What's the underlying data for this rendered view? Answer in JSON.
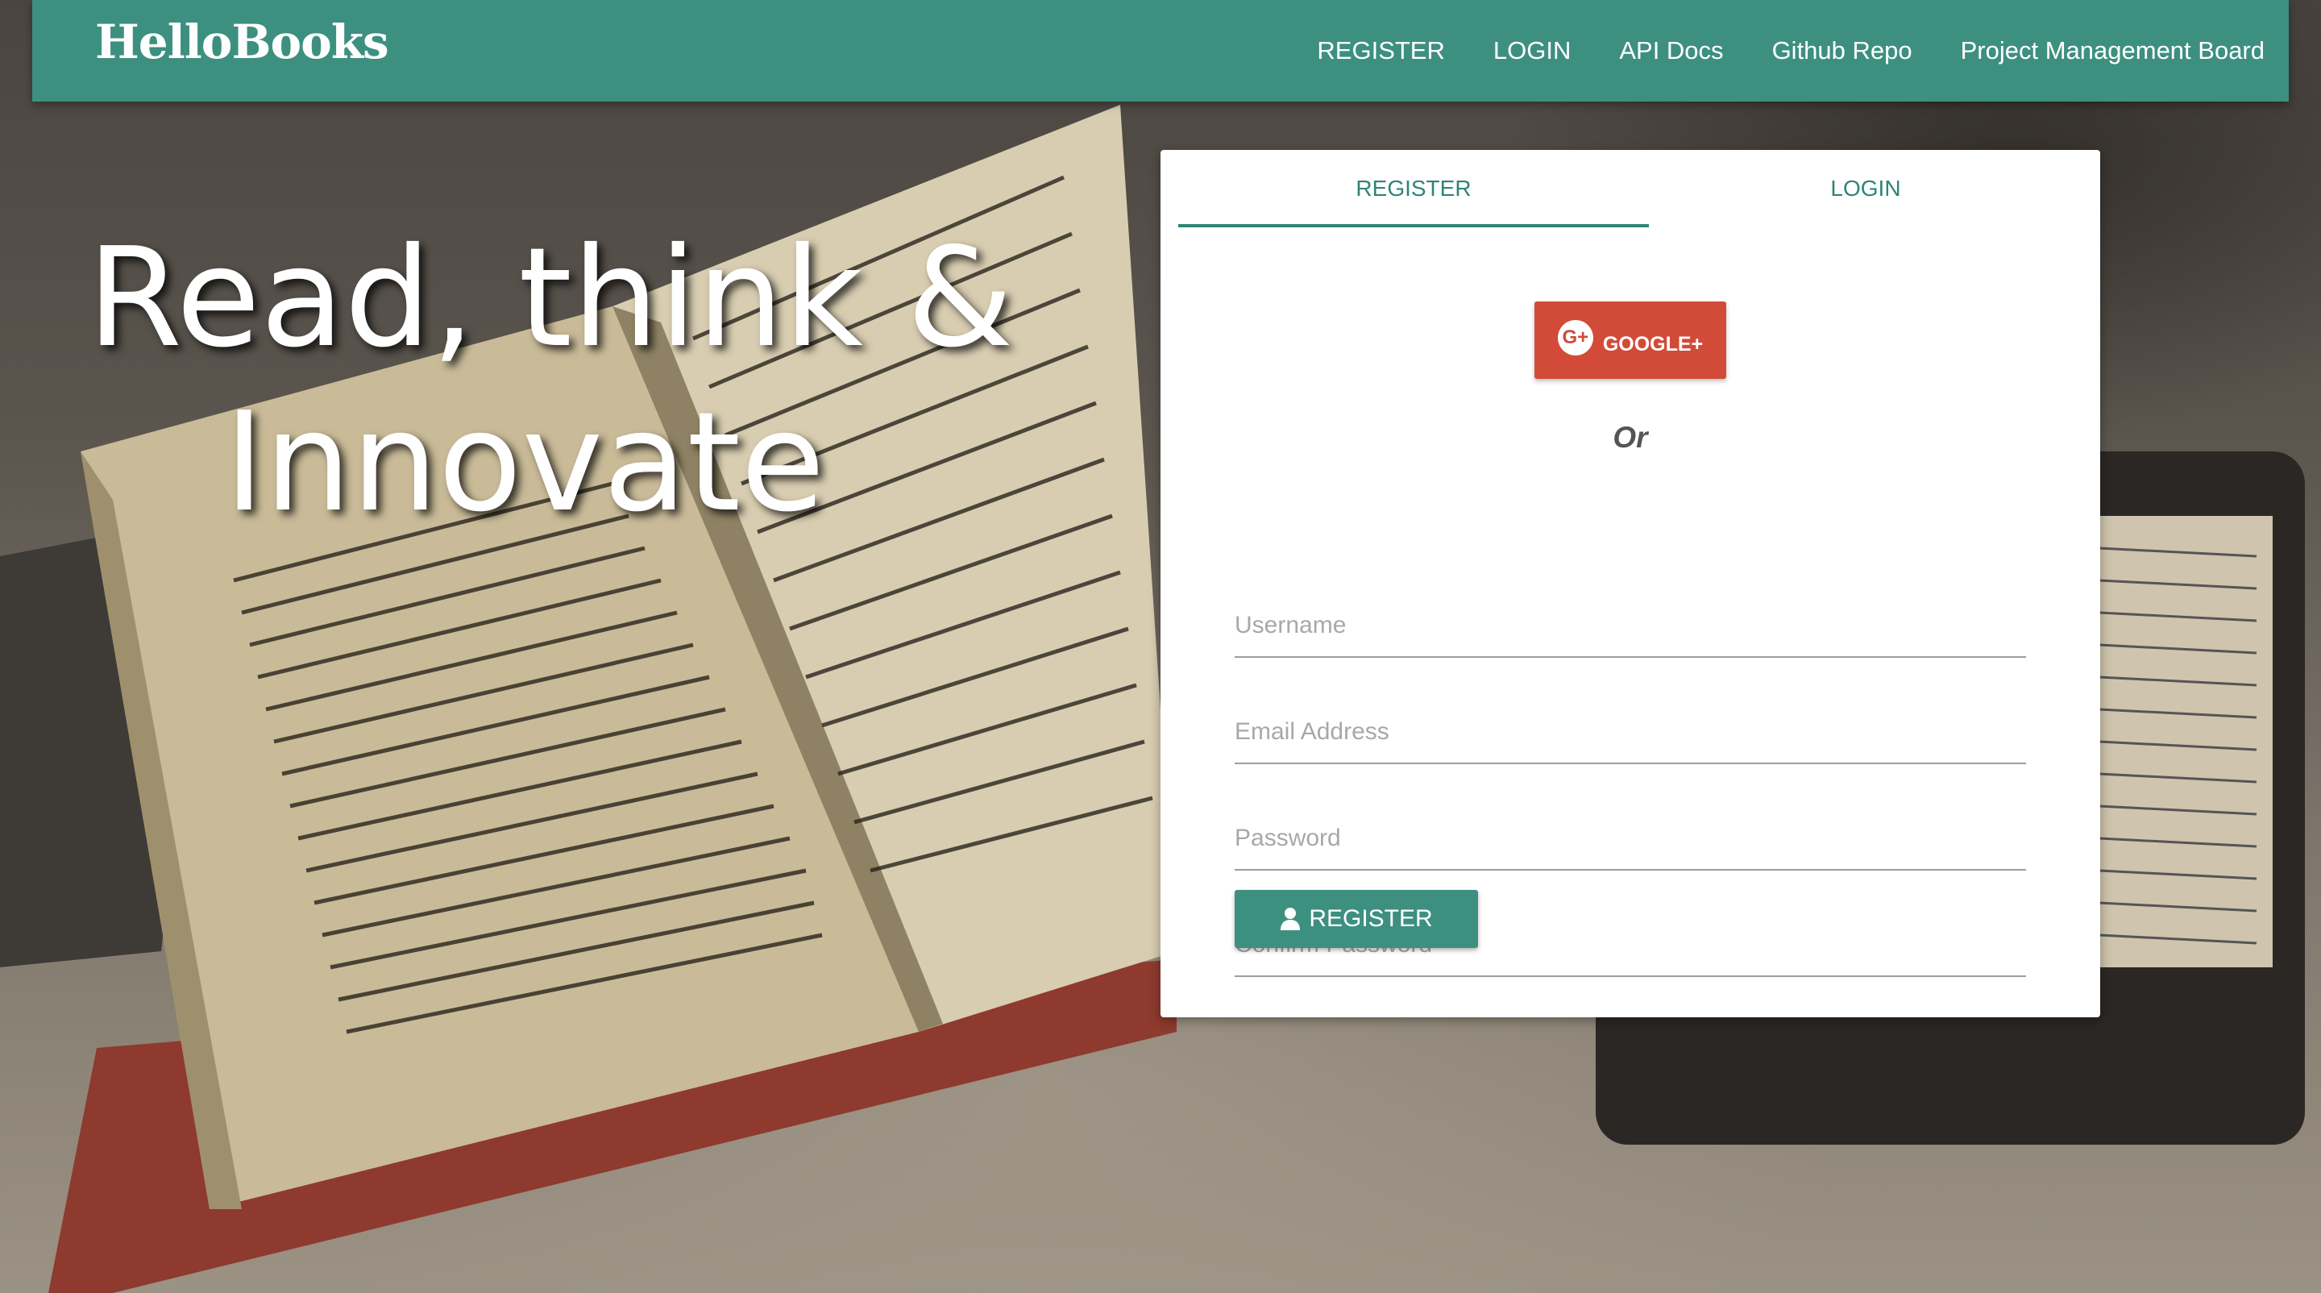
{
  "navbar": {
    "brand": "HelloBooks",
    "links": [
      "REGISTER",
      "LOGIN",
      "API Docs",
      "Github Repo",
      "Project Management Board"
    ],
    "background": "#3d9080"
  },
  "hero": {
    "line1": "Read, think &",
    "line2": "Innovate"
  },
  "auth": {
    "tabs": [
      "REGISTER",
      "LOGIN"
    ],
    "active_tab": "REGISTER",
    "google_label": "GOOGLE+",
    "google_icon": "google-plus-icon",
    "or_text": "Or",
    "fields": {
      "username_placeholder": "Username",
      "email_placeholder": "Email Address",
      "password_placeholder": "Password",
      "confirm_placeholder": "Confirm Password"
    },
    "submit_label": "REGISTER",
    "submit_icon": "user-icon"
  },
  "colors": {
    "accent": "#3d9080",
    "google": "#d24b38"
  }
}
